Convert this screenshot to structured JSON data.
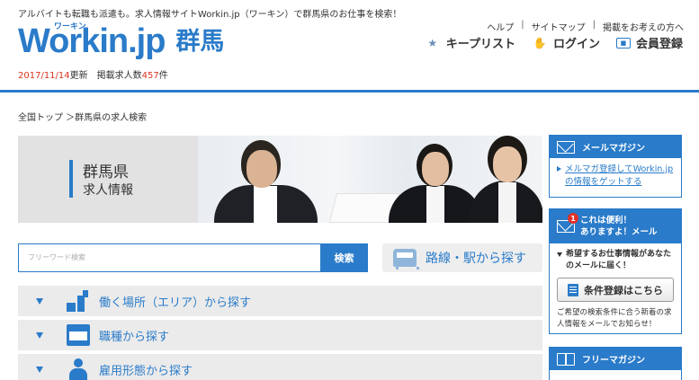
{
  "header": {
    "tagline": "アルバイトも転職も派遣も。求人情報サイトWorkin.jp（ワーキン）で群馬県のお仕事を検索！",
    "logo_ruby": "ワーキン",
    "logo_text": "Workin.jp",
    "region": "群馬",
    "update_date": "2017/11/14",
    "update_suffix": "更新",
    "count_prefix": "掲載求人数",
    "count_value": "457",
    "count_suffix": "件",
    "top_links": [
      "ヘルプ",
      "サイトマップ",
      "掲載をお考えの方へ"
    ],
    "separator": "|",
    "actions": [
      {
        "label": "キープリスト",
        "icon": "keep-list-icon"
      },
      {
        "label": "ログイン",
        "icon": "login-hand-icon"
      },
      {
        "label": "会員登録",
        "icon": "member-card-icon"
      }
    ]
  },
  "breadcrumb": "全国トップ ＞群馬県の求人検索",
  "hero": {
    "prefecture": "群馬県",
    "subtitle": "求人情報"
  },
  "search": {
    "placeholder": "フリーワード検索",
    "value": "",
    "button_label": "検索",
    "route_label": "路線・駅から探す"
  },
  "accordion": [
    {
      "label": "働く場所（エリア）から探す",
      "icon": "map-area-icon"
    },
    {
      "label": "職種から探す",
      "icon": "shop-icon"
    },
    {
      "label": "雇用形態から探す",
      "icon": "person-icon"
    }
  ],
  "sidebar": {
    "mail_magazine": {
      "title": "メールマガジン",
      "link": "メルマガ登録してWorkin.jpの情報をゲットする"
    },
    "benefit": {
      "badge": "1",
      "title_line1": "これは便利！",
      "title_line2": "ありますよ！メール",
      "lead": "希望するお仕事情報があなたのメールに届く！",
      "button_label": "条件登録はこちら",
      "note": "ご希望の検索条件に合う新着の求人情報をメールでお知らせ！"
    },
    "free_magazine": {
      "title": "フリーマガジン"
    }
  },
  "colors": {
    "brand_blue": "#2a7bc9",
    "accent_red": "#d9341f",
    "panel_gray": "#ebebeb"
  }
}
